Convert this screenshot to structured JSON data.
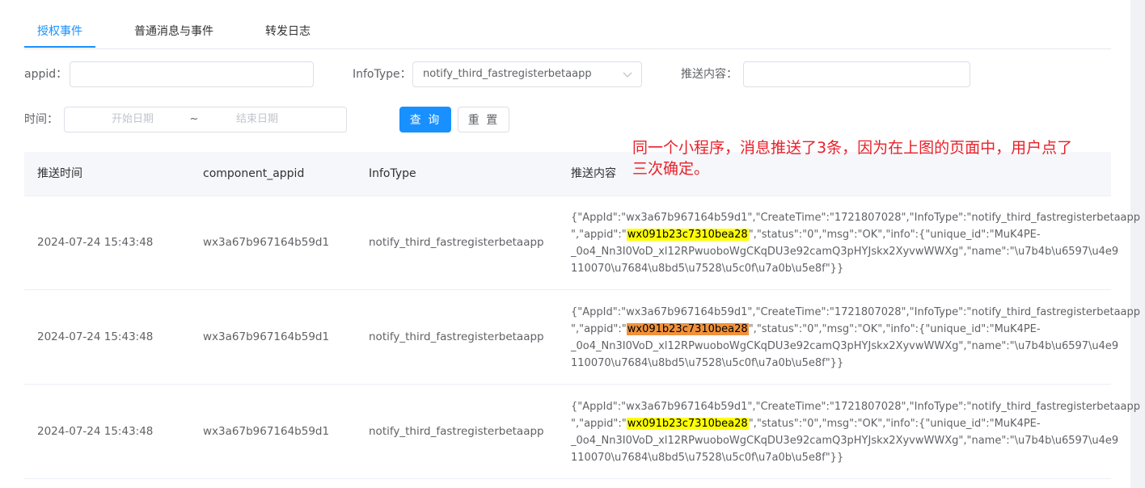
{
  "tabs": [
    {
      "label": "授权事件",
      "active": true
    },
    {
      "label": "普通消息与事件",
      "active": false
    },
    {
      "label": "转发日志",
      "active": false
    }
  ],
  "form": {
    "appid_label": "appid：",
    "appid_value": "",
    "infotype_label": "InfoType：",
    "infotype_value": "notify_third_fastregisterbetaapp",
    "push_content_label": "推送内容：",
    "push_content_value": "",
    "time_label": "时间：",
    "start_placeholder": "开始日期",
    "range_sep": "~",
    "end_placeholder": "结束日期",
    "query_button": "查 询",
    "reset_button": "重 置"
  },
  "table": {
    "headers": [
      "推送时间",
      "component_appid",
      "InfoType",
      "推送内容"
    ],
    "rows": [
      {
        "time": "2024-07-24 15:43:48",
        "component_appid": "wx3a67b967164b59d1",
        "infotype": "notify_third_fastregisterbetaapp",
        "line1": "{\"AppId\":\"wx3a67b967164b59d1\",\"CreateTime\":\"1721807028\",\"InfoType\":\"notify_third_fastregisterbetaapp",
        "line2_pre": "\",\"appid\":\"",
        "line2_hl": "wx091b23c7310bea28",
        "line2_post": "\",\"status\":\"0\",\"msg\":\"OK\",\"info\":{\"unique_id\":\"MuK4PE-",
        "line3": "_0o4_Nn3I0VoD_xl12RPwuoboWgCKqDU3e92camQ3pHYJskx2XyvwWWXg\",\"name\":\"\\u7b4b\\u6597\\u4e9",
        "line4": "110070\\u7684\\u8bd5\\u7528\\u5c0f\\u7a0b\\u5e8f\"}}",
        "highlight_color": "#ffff00"
      },
      {
        "time": "2024-07-24 15:43:48",
        "component_appid": "wx3a67b967164b59d1",
        "infotype": "notify_third_fastregisterbetaapp",
        "line1": "{\"AppId\":\"wx3a67b967164b59d1\",\"CreateTime\":\"1721807028\",\"InfoType\":\"notify_third_fastregisterbetaapp",
        "line2_pre": "\",\"appid\":\"",
        "line2_hl": "wx091b23c7310bea28",
        "line2_post": "\",\"status\":\"0\",\"msg\":\"OK\",\"info\":{\"unique_id\":\"MuK4PE-",
        "line3": "_0o4_Nn3I0VoD_xl12RPwuoboWgCKqDU3e92camQ3pHYJskx2XyvwWWXg\",\"name\":\"\\u7b4b\\u6597\\u4e9",
        "line4": "110070\\u7684\\u8bd5\\u7528\\u5c0f\\u7a0b\\u5e8f\"}}",
        "highlight_color": "#f0923c"
      },
      {
        "time": "2024-07-24 15:43:48",
        "component_appid": "wx3a67b967164b59d1",
        "infotype": "notify_third_fastregisterbetaapp",
        "line1": "{\"AppId\":\"wx3a67b967164b59d1\",\"CreateTime\":\"1721807028\",\"InfoType\":\"notify_third_fastregisterbetaapp",
        "line2_pre": "\",\"appid\":\"",
        "line2_hl": "wx091b23c7310bea28",
        "line2_post": "\",\"status\":\"0\",\"msg\":\"OK\",\"info\":{\"unique_id\":\"MuK4PE-",
        "line3": "_0o4_Nn3I0VoD_xl12RPwuoboWgCKqDU3e92camQ3pHYJskx2XyvwWWXg\",\"name\":\"\\u7b4b\\u6597\\u4e9",
        "line4": "110070\\u7684\\u8bd5\\u7528\\u5c0f\\u7a0b\\u5e8f\"}}",
        "highlight_color": "#ffff00"
      }
    ]
  },
  "annotation": {
    "line1": "同一个小程序，消息推送了3条，因为在上图的页面中，用户点了",
    "line2": "三次确定。"
  },
  "colors": {
    "accent": "#1890ff",
    "annotation_red": "#e8202a"
  }
}
